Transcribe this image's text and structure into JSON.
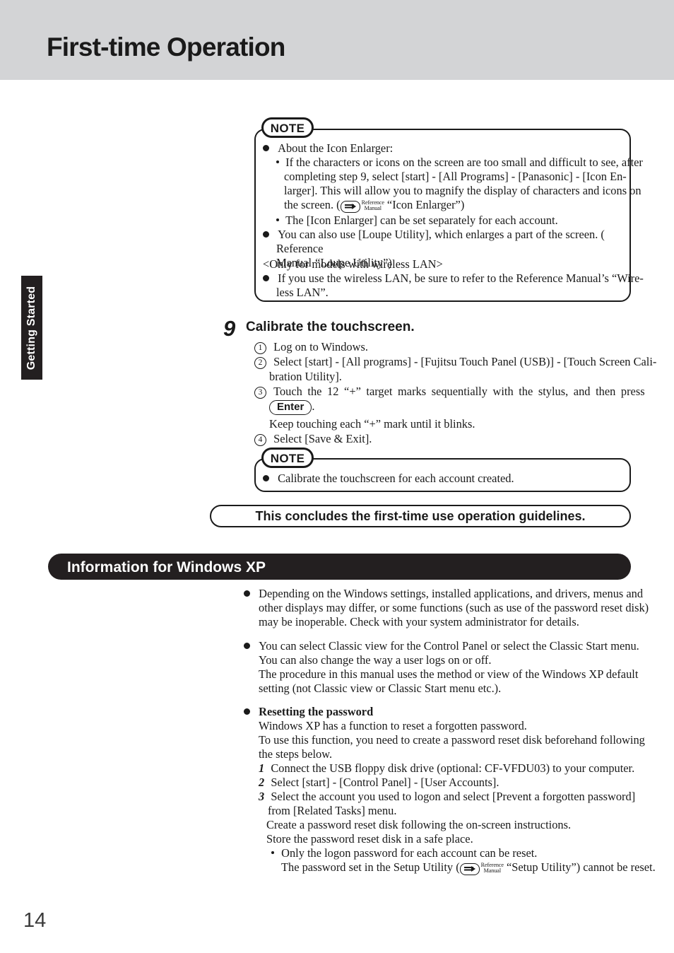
{
  "header": {
    "title": "First-time Operation",
    "band_color": "#d3d4d6"
  },
  "side_tab": {
    "label": "Getting Started",
    "bg_color": "#231f20",
    "text_color": "#ffffff"
  },
  "page_number": "14",
  "reference_manual_glyph": {
    "line1": "Reference",
    "line2": "Manual",
    "icon": "pointing-hand-icon"
  },
  "note_box_top": {
    "badge": "NOTE",
    "lines": [
      {
        "marker": "bullet",
        "indent": 0,
        "text": "About the Icon Enlarger:"
      },
      {
        "marker": "dash",
        "indent": 1,
        "text": "If the characters or icons on the screen are too small and difficult to see, after"
      },
      {
        "marker": "none",
        "indent": 2,
        "text": "completing step 9, select [start] - [All Programs] - [Panasonic] - [Icon En-"
      },
      {
        "marker": "none",
        "indent": 2,
        "text": "larger].  This will allow you to magnify the display of characters and icons on"
      },
      {
        "marker": "none",
        "indent": 2,
        "text": "the screen. (",
        "refman": true,
        "text_after": "“Icon Enlarger”)"
      },
      {
        "marker": "dash",
        "indent": 1,
        "text": "The [Icon Enlarger] can be set separately for each account."
      },
      {
        "marker": "bullet",
        "indent": 0,
        "text": "You can also use [Loupe Utility], which enlarges a part of the screen. (",
        "hand_trailing": true
      },
      {
        "marker": "none",
        "indent": 1,
        "refman_lead": true,
        "text": "“Loupe Utility”)"
      },
      {
        "marker": "none",
        "indent": 0,
        "text": "<Only for models with wireless LAN>"
      },
      {
        "marker": "bullet",
        "indent": 0,
        "text": "If you use the wireless LAN, be sure to refer to the Reference Manual’s “Wire-"
      },
      {
        "marker": "none",
        "indent": 1,
        "text": "less LAN”."
      }
    ]
  },
  "step9": {
    "number": "9",
    "title": "Calibrate the touchscreen.",
    "items": [
      {
        "num": "1",
        "lines": [
          "Log on to Windows."
        ]
      },
      {
        "num": "2",
        "lines": [
          "Select [start] - [All programs] - [Fujitsu Touch Panel (USB)] - [Touch Screen Cali-",
          "bration Utility]."
        ]
      },
      {
        "num": "3",
        "lines": [
          "Touch the 12 “+” target marks sequentially with the stylus, and then press"
        ]
      },
      {
        "num": "4",
        "lines": [
          "Select [Save & Exit]."
        ]
      }
    ],
    "keycap": "Enter",
    "keycap_suffix": ".",
    "blink_line": "Keep touching each “+” mark until it blinks."
  },
  "note_box_bottom": {
    "badge": "NOTE",
    "lines": [
      {
        "marker": "bullet",
        "text": "Calibrate the touchscreen for each account created."
      }
    ]
  },
  "conclusion_banner": {
    "text": "This concludes the first-time use operation guidelines."
  },
  "section": {
    "banner_label": "Information for Windows XP",
    "banner_color": "#231f20",
    "blocks": [
      {
        "marker": "bullet",
        "lines": [
          "Depending on the Windows settings, installed applications, and drivers, menus and",
          "other displays may differ, or some functions (such as use of the password reset disk)",
          "may be inoperable.  Check with your system administrator for details."
        ]
      },
      {
        "marker": "bullet",
        "lines": [
          "You can select Classic view for the Control Panel or select the Classic Start menu.",
          "You can also change the way a user logs on or off.",
          "The procedure in this manual uses the method or view of the Windows XP default",
          "setting (not Classic view or Classic Start menu etc.)."
        ]
      }
    ],
    "password_block": {
      "marker": "bullet",
      "heading": "Resetting the password",
      "intro": [
        "Windows XP has a function to reset a forgotten password.",
        "To use this function, you need to create a password reset disk beforehand following",
        "the steps below."
      ],
      "steps": [
        {
          "num": "1",
          "lines": [
            "Connect the USB floppy disk drive (optional: CF-VFDU03) to your computer."
          ]
        },
        {
          "num": "2",
          "lines": [
            "Select [start] - [Control Panel] - [User Accounts]."
          ]
        },
        {
          "num": "3",
          "lines": [
            "Select the account you used to logon and select [Prevent a forgotten password]",
            "from [Related Tasks] menu."
          ]
        }
      ],
      "tail": [
        "Create a password reset disk following the on-screen instructions.",
        "Store the password reset disk in a safe place."
      ],
      "subdot": "Only the logon password for each account can be reset.",
      "final_pre": "The password set in the Setup Utility (",
      "final_post": "“Setup Utility”) cannot be reset."
    }
  }
}
